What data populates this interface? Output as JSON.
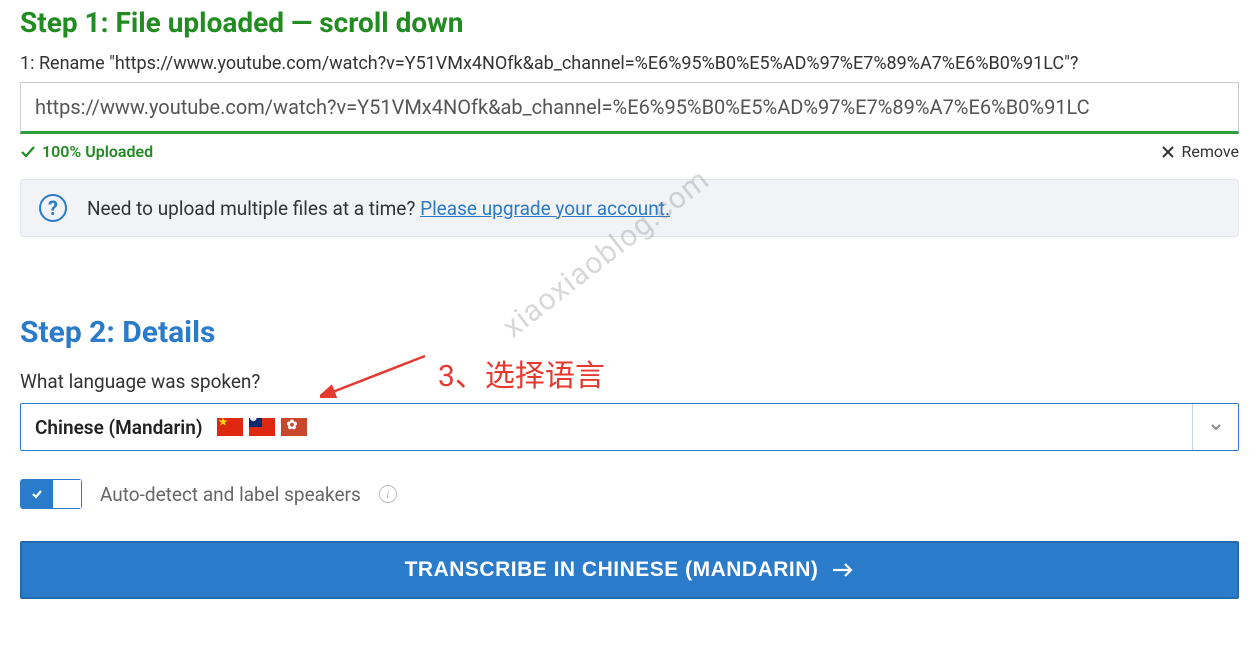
{
  "step1": {
    "title": "Step 1: File uploaded — scroll down",
    "rename_label": "1: Rename \"https://www.youtube.com/watch?v=Y51VMx4NOfk&ab_channel=%E6%95%B0%E5%AD%97%E7%89%A7%E6%B0%91LC\"?",
    "url_value": "https://www.youtube.com/watch?v=Y51VMx4NOfk&ab_channel=%E6%95%B0%E5%AD%97%E7%89%A7%E6%B0%91LC",
    "uploaded_status": "100% Uploaded",
    "remove_label": "Remove"
  },
  "banner": {
    "text": "Need to upload multiple files at a time? ",
    "link_text": "Please upgrade your account."
  },
  "step2": {
    "title": "Step 2: Details",
    "lang_question": "What language was spoken?",
    "selected_lang": "Chinese (Mandarin)",
    "toggle_label": "Auto-detect and label speakers",
    "button_label": "TRANSCRIBE IN CHINESE (MANDARIN)"
  },
  "annotation": {
    "text": "3、选择语言"
  },
  "watermark": "xiaoxiaoblog.com"
}
